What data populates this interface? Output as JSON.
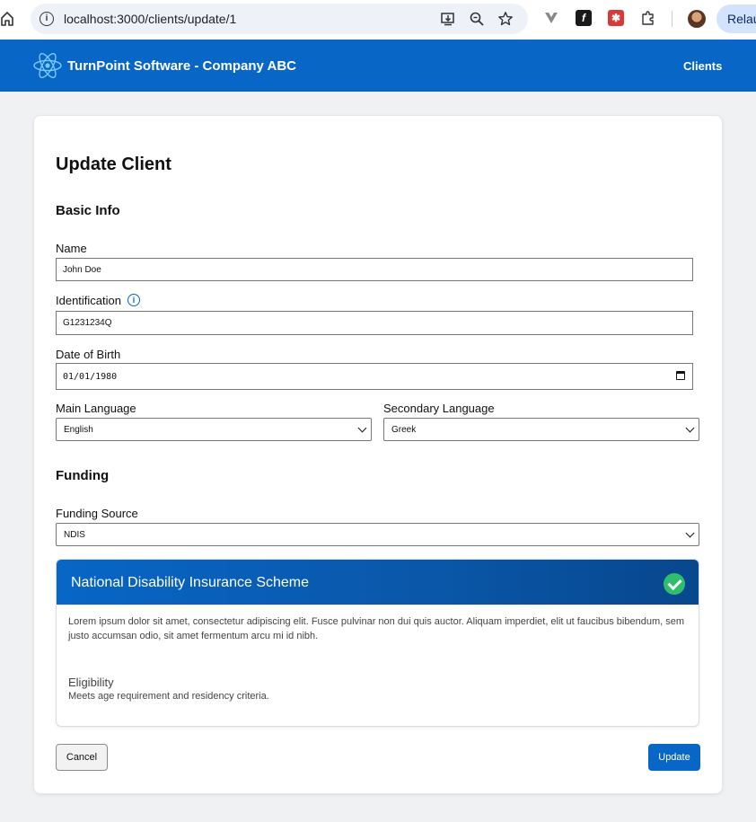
{
  "browser": {
    "url": "localhost:3000/clients/update/1",
    "relaunch_label": "Relau"
  },
  "app": {
    "title": "TurnPoint Software - Company ABC",
    "nav": {
      "clients_label": "Clients"
    },
    "brand_color": "#0866c6"
  },
  "form": {
    "page_title": "Update Client",
    "basic_info_title": "Basic Info",
    "name": {
      "label": "Name",
      "value": "John Doe"
    },
    "identification": {
      "label": "Identification",
      "value": "G1231234Q"
    },
    "dob": {
      "label": "Date of Birth",
      "value": "01/01/1980"
    },
    "main_language": {
      "label": "Main Language",
      "value": "English"
    },
    "secondary_language": {
      "label": "Secondary Language",
      "value": "Greek"
    },
    "funding_title": "Funding",
    "funding_source": {
      "label": "Funding Source",
      "value": "NDIS"
    }
  },
  "funding_panel": {
    "title": "National Disability Insurance Scheme",
    "description": "Lorem ipsum dolor sit amet, consectetur adipiscing elit. Fusce pulvinar non dui quis auctor. Aliquam imperdiet, elit ut faucibus bibendum, sem justo accumsan odio, sit amet fermentum arcu mi id nibh.",
    "eligibility_title": "Eligibility",
    "eligibility_text": "Meets age requirement and residency criteria.",
    "status_color": "#2fbf6c"
  },
  "actions": {
    "cancel_label": "Cancel",
    "update_label": "Update"
  },
  "icons": [
    "home-icon",
    "info-icon",
    "install-icon",
    "zoom-icon",
    "star-icon",
    "extension-icons",
    "puzzle-icon",
    "check-circle-icon",
    "react-logo"
  ]
}
